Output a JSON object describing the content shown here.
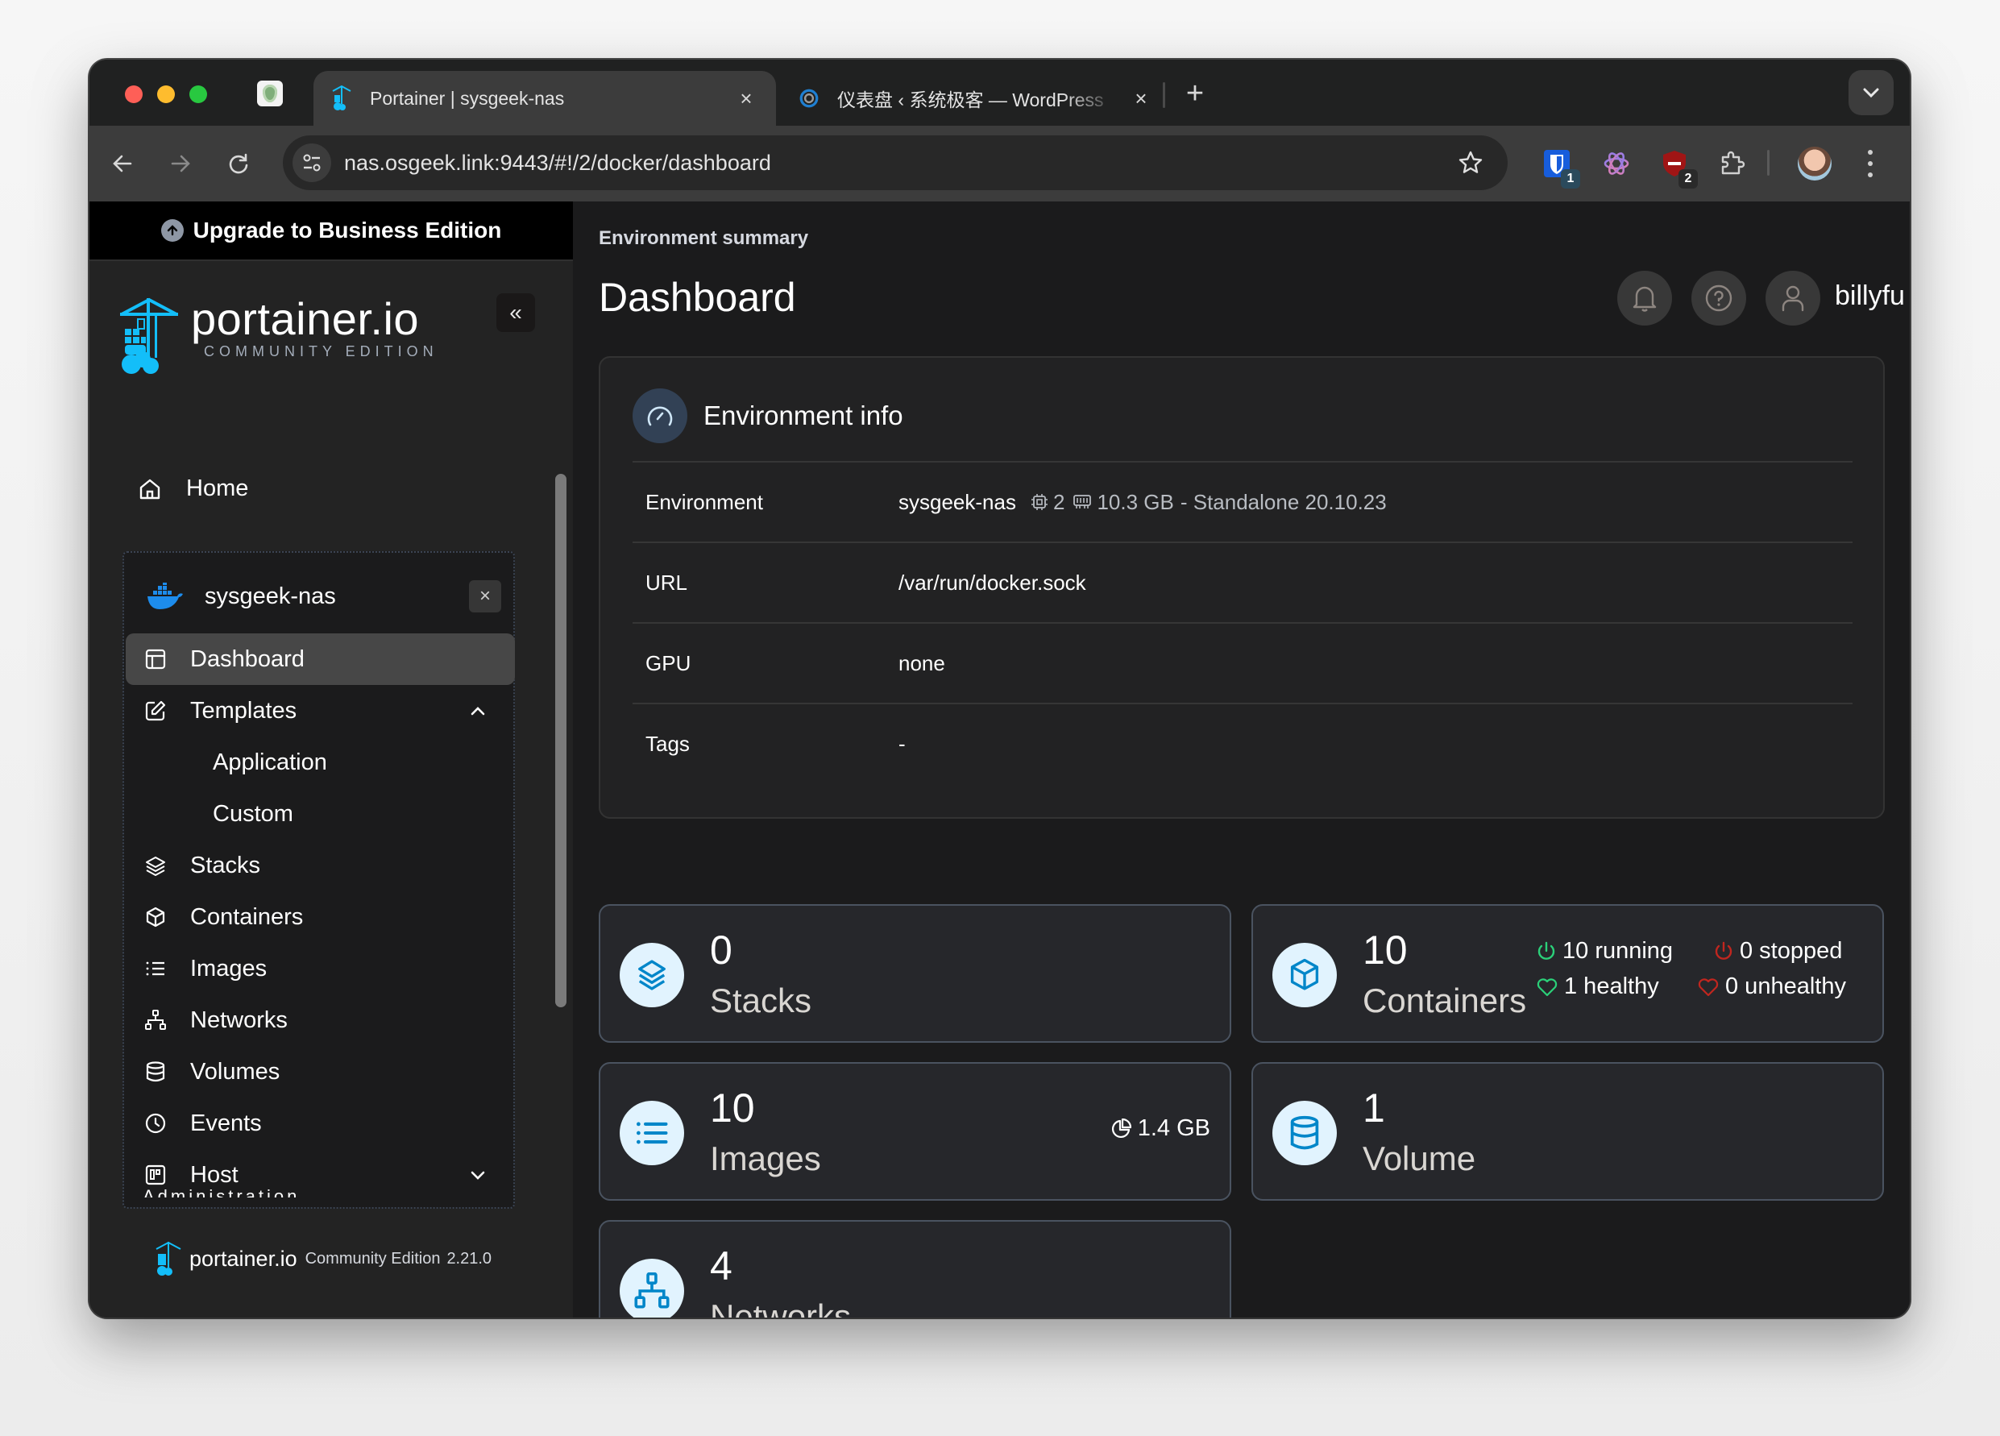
{
  "browser": {
    "tabs": [
      {
        "title": "Portainer | sysgeek-nas",
        "active": true
      },
      {
        "title": "仪表盘 ‹ 系统极客 — WordPress",
        "active": false
      }
    ],
    "close_glyph": "×",
    "new_tab_glyph": "+",
    "url": "nas.osgeek.link:9443/#!/2/docker/dashboard",
    "extensions": [
      {
        "name": "bitwarden",
        "badge": "1"
      },
      {
        "name": "chatgpt",
        "badge": ""
      },
      {
        "name": "shield-blocker",
        "badge": "2"
      },
      {
        "name": "extensions-puzzle",
        "badge": ""
      }
    ]
  },
  "sidebar": {
    "upgrade_label": "Upgrade to Business Edition",
    "brand_name": "portainer.io",
    "brand_edition": "COMMUNITY EDITION",
    "collapse_glyph": "«",
    "home_label": "Home",
    "environment": {
      "name": "sysgeek-nas",
      "close_glyph": "×"
    },
    "menu": [
      {
        "label": "Dashboard",
        "icon": "layout-icon",
        "active": true
      },
      {
        "label": "Templates",
        "icon": "edit-icon",
        "expanded": true
      },
      {
        "label": "Application",
        "sub": true
      },
      {
        "label": "Custom",
        "sub": true
      },
      {
        "label": "Stacks",
        "icon": "layers-icon"
      },
      {
        "label": "Containers",
        "icon": "box-icon"
      },
      {
        "label": "Images",
        "icon": "list-icon"
      },
      {
        "label": "Networks",
        "icon": "network-icon"
      },
      {
        "label": "Volumes",
        "icon": "database-icon"
      },
      {
        "label": "Events",
        "icon": "clock-icon"
      },
      {
        "label": "Host",
        "icon": "host-icon",
        "expanded": false
      }
    ],
    "admin_label": "Administration",
    "footer": {
      "name": "portainer.io",
      "edition": "Community Edition",
      "version": "2.21.0"
    }
  },
  "header": {
    "breadcrumb": "Environment summary",
    "title": "Dashboard",
    "username": "billyfu"
  },
  "env_info": {
    "title": "Environment info",
    "rows": [
      {
        "key": "Environment",
        "value": "sysgeek-nas",
        "cpu": "2",
        "memory": "10.3 GB",
        "mode": "- Standalone 20.10.23"
      },
      {
        "key": "URL",
        "value": "/var/run/docker.sock"
      },
      {
        "key": "GPU",
        "value": "none"
      },
      {
        "key": "Tags",
        "value": "-"
      }
    ]
  },
  "stats": {
    "stacks": {
      "count": "0",
      "label": "Stacks"
    },
    "containers": {
      "count": "10",
      "label": "Containers",
      "running": "10 running",
      "stopped": "0 stopped",
      "healthy": "1 healthy",
      "unhealthy": "0 unhealthy"
    },
    "images": {
      "count": "10",
      "label": "Images",
      "size": "1.4 GB"
    },
    "volumes": {
      "count": "1",
      "label": "Volume"
    },
    "networks": {
      "count": "4",
      "label": "Networks"
    }
  },
  "colors": {
    "accent_blue": "#0086c9",
    "icon_bg": "#e1f3fe",
    "success": "#2bd079",
    "danger": "#c0261f"
  }
}
